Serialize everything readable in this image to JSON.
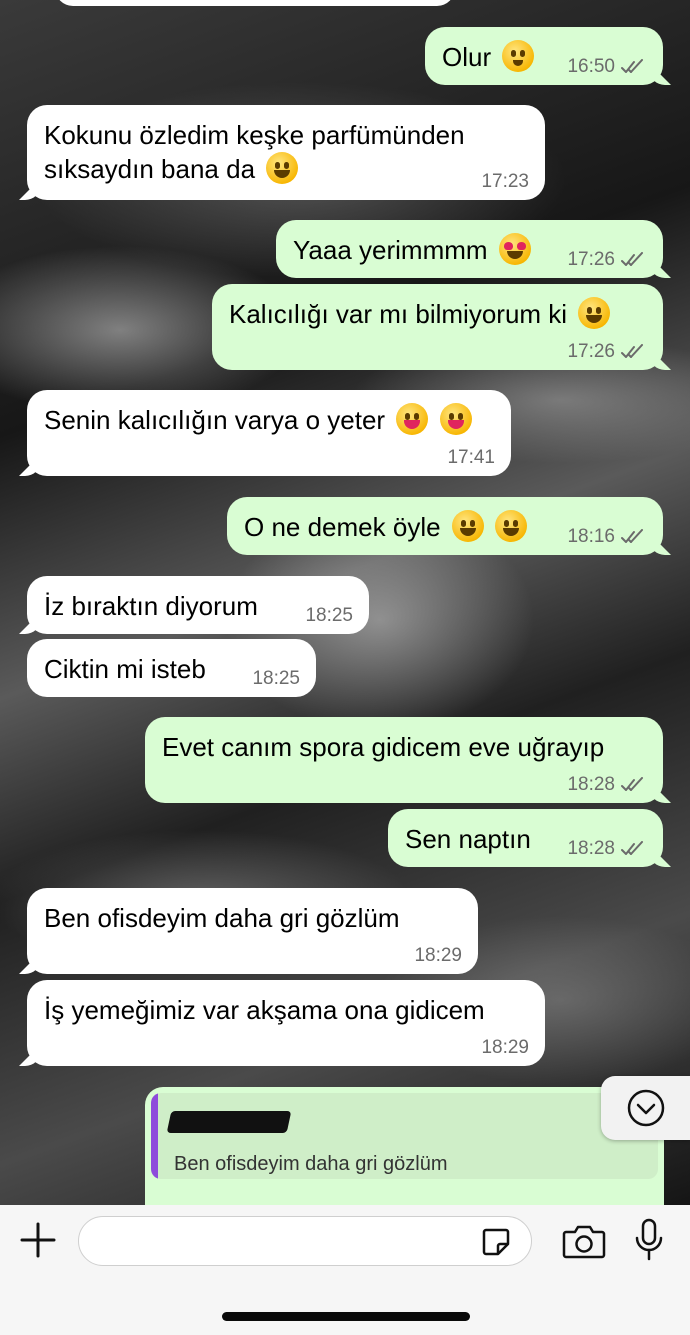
{
  "messages": [
    {
      "dir": "out",
      "text": "Olur",
      "emoji": [
        "hug"
      ],
      "time": "16:50",
      "ticks": true
    },
    {
      "dir": "in",
      "text": "Kokunu özledim keşke parfümünden sıksaydın bana da",
      "emoji": [
        "grin"
      ],
      "time": "17:23"
    },
    {
      "dir": "out",
      "text": "Yaaa yerimmmm",
      "emoji": [
        "heart"
      ],
      "time": "17:26",
      "ticks": true
    },
    {
      "dir": "out",
      "text": "Kalıcılığı var mı bilmiyorum ki",
      "emoji": [
        "smile"
      ],
      "time": "17:26",
      "ticks": true
    },
    {
      "dir": "in",
      "text": "Senin kalıcılığın varya o yeter",
      "emoji": [
        "tongue",
        "tongue"
      ],
      "time": "17:41"
    },
    {
      "dir": "out",
      "text": "O ne demek öyle",
      "emoji": [
        "grin",
        "grin"
      ],
      "time": "18:16",
      "ticks": true
    },
    {
      "dir": "in",
      "text": "İz bıraktın diyorum",
      "time": "18:25"
    },
    {
      "dir": "in",
      "text": "Ciktin mi isteb",
      "time": "18:25"
    },
    {
      "dir": "out",
      "text": "Evet canım spora gidicem eve uğrayıp",
      "time": "18:28",
      "ticks": true
    },
    {
      "dir": "out",
      "text": "Sen naptın",
      "time": "18:28",
      "ticks": true
    },
    {
      "dir": "in",
      "text": "Ben ofisdeyim daha gri gözlüm",
      "time": "18:29"
    },
    {
      "dir": "in",
      "text": "İş yemeğimiz var akşama ona gidicem",
      "time": "18:29"
    }
  ],
  "reply_preview": {
    "quoted_text": "Ben ofisdeyim daha gri gözlüm"
  },
  "composer": {
    "placeholder": ""
  },
  "colors": {
    "incoming": "#ffffff",
    "outgoing": "#d9fdd3",
    "reply_bar": "#8e4bdb"
  },
  "icons": {
    "scroll": "chevron-down-icon",
    "attach": "plus-icon",
    "sticker": "sticker-icon",
    "camera": "camera-icon",
    "mic": "microphone-icon"
  }
}
